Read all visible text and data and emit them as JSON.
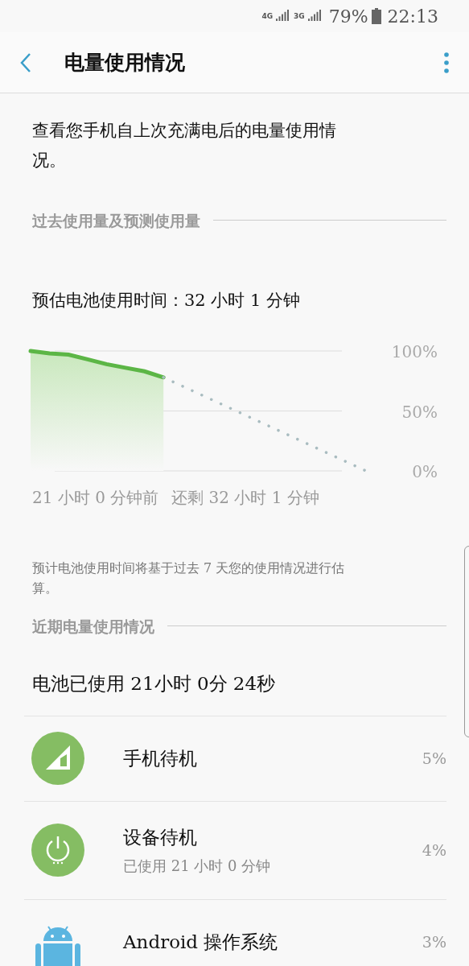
{
  "status_bar": {
    "network_1": "4G",
    "network_2": "3G",
    "battery": "79%",
    "time": "22:13"
  },
  "header": {
    "title": "电量使用情况"
  },
  "intro": "查看您手机自上次充满电后的电量使用情况。",
  "sections": [
    {
      "title": "过去使用量及预测使用量"
    },
    {
      "title": "近期电量使用情况"
    }
  ],
  "estimate": "预估电池使用时间：32 小时 1 分钟",
  "chart": {
    "start_label": "21 小时 0 分钟前",
    "end_label": "还剩 32 小时 1 分钟",
    "y_labels": [
      "100%",
      "50%",
      "0%"
    ]
  },
  "note": "预计电池使用时间将基于过去 7 天您的使用情况进行估算。",
  "used": "电池已使用 21小时 0分 24秒",
  "apps": [
    {
      "kind": "signal",
      "name": "手机待机",
      "percent": "5%"
    },
    {
      "kind": "power",
      "name": "设备待机",
      "detail": "已使用 21 小时 0 分钟",
      "percent": "4%"
    },
    {
      "kind": "android",
      "name": "Android 操作系统",
      "percent": "3%"
    }
  ]
}
